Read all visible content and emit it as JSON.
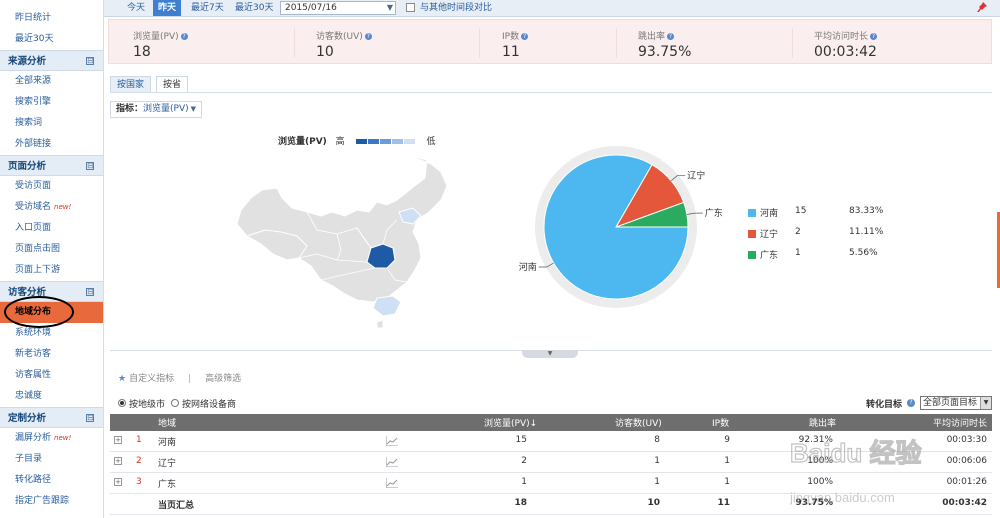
{
  "sidebar": {
    "top_items": [
      "昨日统计",
      "最近30天"
    ],
    "sections": [
      {
        "title": "来源分析",
        "items": [
          {
            "label": "全部来源"
          },
          {
            "label": "搜索引擎"
          },
          {
            "label": "搜索词"
          },
          {
            "label": "外部链接"
          }
        ]
      },
      {
        "title": "页面分析",
        "items": [
          {
            "label": "受访页面"
          },
          {
            "label": "受访域名",
            "badge": "new!"
          },
          {
            "label": "入口页面"
          },
          {
            "label": "页面点击图"
          },
          {
            "label": "页面上下游"
          }
        ]
      },
      {
        "title": "访客分析",
        "items": [
          {
            "label": "地域分布",
            "active": true
          },
          {
            "label": "系统环境"
          },
          {
            "label": "新老访客"
          },
          {
            "label": "访客属性"
          },
          {
            "label": "忠诚度"
          }
        ]
      },
      {
        "title": "定制分析",
        "items": [
          {
            "label": "漏屏分析",
            "badge": "new!"
          },
          {
            "label": "子目录"
          },
          {
            "label": "转化路径"
          },
          {
            "label": "指定广告跟踪"
          }
        ]
      }
    ],
    "toggle": "⊟"
  },
  "topbar": {
    "buttons": [
      "今天",
      "昨天",
      "最近7天",
      "最近30天"
    ],
    "selected": "昨天",
    "date": "2015/07/16",
    "compare_label": "与其他时间段对比"
  },
  "stats": [
    {
      "label": "浏览量(PV)",
      "value": "18"
    },
    {
      "label": "访客数(UV)",
      "value": "10"
    },
    {
      "label": "IP数",
      "value": "11"
    },
    {
      "label": "跳出率",
      "value": "93.75%"
    },
    {
      "label": "平均访问时长",
      "value": "00:03:42"
    }
  ],
  "tabs": [
    "按国家",
    "按省"
  ],
  "selected_tab": "按省",
  "metric": {
    "key": "指标：",
    "value": "浏览量(PV)"
  },
  "map_legend": {
    "title": "浏览量(PV)",
    "high": "高",
    "low": "低",
    "colors": [
      "#1f5aa6",
      "#3b78c3",
      "#6a9bd6",
      "#9fc1e8",
      "#cfe0f4"
    ]
  },
  "chart_data": {
    "type": "pie",
    "categories": [
      "河南",
      "辽宁",
      "广东"
    ],
    "values": [
      15,
      2,
      1
    ],
    "percents": [
      "83.33%",
      "11.11%",
      "5.56%"
    ],
    "colors": [
      "#4cb8ef",
      "#e4573a",
      "#2aab60"
    ]
  },
  "custom_row": {
    "star_label": "自定义指标",
    "sep": "|",
    "filter_label": "高级筛选"
  },
  "options": {
    "radio1": "按地级市",
    "radio2": "按网络设备商",
    "conv_label": "转化目标",
    "conv_value": "全部页面目标"
  },
  "table": {
    "headers": [
      "地域",
      "浏览量(PV)",
      "访客数(UV)",
      "IP数",
      "跳出率",
      "平均访问时长"
    ],
    "sort_arrow": "↓",
    "rows": [
      {
        "rank": "1",
        "region": "河南",
        "pv": "15",
        "uv": "8",
        "ip": "9",
        "bounce": "92.31%",
        "time": "00:03:30"
      },
      {
        "rank": "2",
        "region": "辽宁",
        "pv": "2",
        "uv": "1",
        "ip": "1",
        "bounce": "100%",
        "time": "00:06:06"
      },
      {
        "rank": "3",
        "region": "广东",
        "pv": "1",
        "uv": "1",
        "ip": "1",
        "bounce": "100%",
        "time": "00:01:26"
      }
    ],
    "total": {
      "label": "当页汇总",
      "pv": "18",
      "uv": "10",
      "ip": "11",
      "bounce": "93.75%",
      "time": "00:03:42"
    }
  },
  "watermark": {
    "text": "Baidu 经验",
    "sub": "jingyan.baidu.com"
  }
}
